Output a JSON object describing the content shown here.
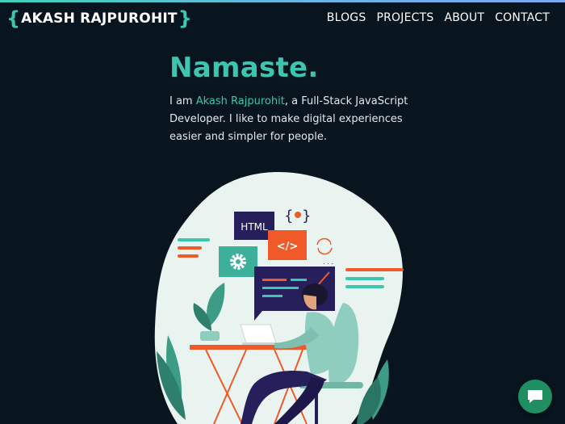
{
  "header": {
    "logo_open": "{",
    "logo_name": "AKASH RAJPUROHIT",
    "logo_close": "}",
    "nav": [
      "BLOGS",
      "PROJECTS",
      "ABOUT",
      "CONTACT"
    ]
  },
  "hero": {
    "title": "Namaste.",
    "intro_prefix": "I am ",
    "intro_name": "Akash Rajpurohit",
    "intro_suffix": ", a Full-Stack JavaScript Developer. I like to make digital experiences easier and simpler for people."
  },
  "illustration": {
    "html_label": "HTML",
    "code_label": "</>",
    "braces_label": "{",
    "braces_close": "}"
  },
  "colors": {
    "background": "#08151f",
    "accent": "#3cc6b0",
    "orange": "#f05a28",
    "navy": "#261f5c",
    "chat": "#1f8f62"
  },
  "icons": [
    "chat-icon",
    "gear-icon",
    "code-icon",
    "refresh-icon",
    "leaf-icon"
  ]
}
